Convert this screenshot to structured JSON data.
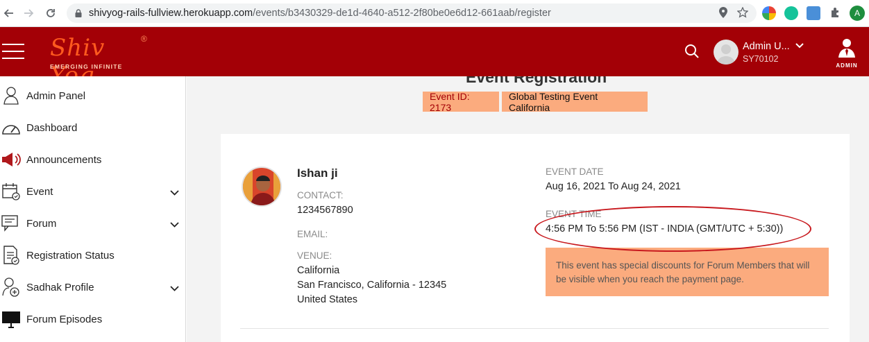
{
  "browser": {
    "url_host": "shivyog-rails-fullview.herokuapp.com",
    "url_path": "/events/b3430329-de1d-4640-a512-2f80be0e6d12-661aab/register",
    "profile_initial": "A"
  },
  "header": {
    "logo_title": "Shiv Yog",
    "logo_reg": "®",
    "logo_tagline": "EMERGING INFINITE",
    "user_name": "Admin U...",
    "user_id": "SY70102",
    "admin_label": "ADMIN"
  },
  "sidebar": {
    "items": [
      {
        "label": "Admin Panel",
        "icon": "user-outline-icon",
        "expandable": false
      },
      {
        "label": "Dashboard",
        "icon": "speedometer-icon",
        "expandable": false
      },
      {
        "label": "Announcements",
        "icon": "megaphone-icon",
        "expandable": false
      },
      {
        "label": "Event",
        "icon": "calendar-icon",
        "expandable": true
      },
      {
        "label": "Forum",
        "icon": "chat-icon",
        "expandable": true
      },
      {
        "label": "Registration Status",
        "icon": "document-check-icon",
        "expandable": false
      },
      {
        "label": "Sadhak Profile",
        "icon": "user-add-icon",
        "expandable": true
      },
      {
        "label": "Forum Episodes",
        "icon": "monitor-icon",
        "expandable": false
      }
    ]
  },
  "main": {
    "title": "Event Registration",
    "event_id": "Event ID: 2173",
    "event_name": "Global Testing Event California",
    "organizer": {
      "name": "Ishan ji",
      "contact_label": "CONTACT:",
      "contact_value": "1234567890",
      "email_label": "EMAIL:",
      "venue_label": "VENUE:",
      "venue_line1": "California",
      "venue_line2": "San Francisco, California - 12345",
      "venue_line3": "United States"
    },
    "event_date_label": "EVENT DATE",
    "event_date_value": "Aug 16, 2021 To Aug 24, 2021",
    "event_time_label": "EVENT TIME",
    "event_time_value": "4:56 PM To 5:56 PM (IST - INDIA (GMT/UTC + 5:30))",
    "discount_note": "This event has special discounts for Forum Members that will be visible when you reach the payment page."
  },
  "colors": {
    "header_bg": "#a30006",
    "accent_pill": "#fbab7e",
    "highlight_ellipse": "#c8191e"
  }
}
